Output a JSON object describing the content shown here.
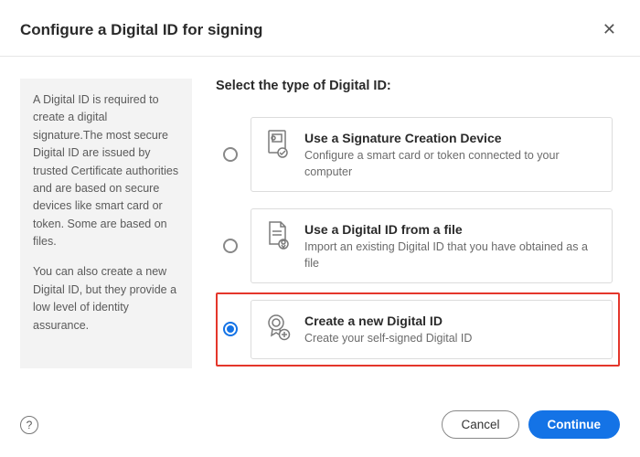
{
  "header": {
    "title": "Configure a Digital ID for signing"
  },
  "sidebar": {
    "para1": "A Digital ID is required to create a digital signature.The most secure Digital ID are issued by trusted Certificate authorities and are based on secure devices like smart card or token. Some are based on files.",
    "para2": "You can also create a new Digital ID, but they provide a low level of identity assurance."
  },
  "main": {
    "heading": "Select the type of Digital ID:"
  },
  "options": [
    {
      "title": "Use a Signature Creation Device",
      "desc": "Configure a smart card or token connected to your computer",
      "selected": false,
      "highlighted": false
    },
    {
      "title": "Use a Digital ID from a file",
      "desc": "Import an existing Digital ID that you have obtained as a file",
      "selected": false,
      "highlighted": false
    },
    {
      "title": "Create a new Digital ID",
      "desc": "Create your self-signed Digital ID",
      "selected": true,
      "highlighted": true
    }
  ],
  "footer": {
    "cancel": "Cancel",
    "continue": "Continue"
  }
}
